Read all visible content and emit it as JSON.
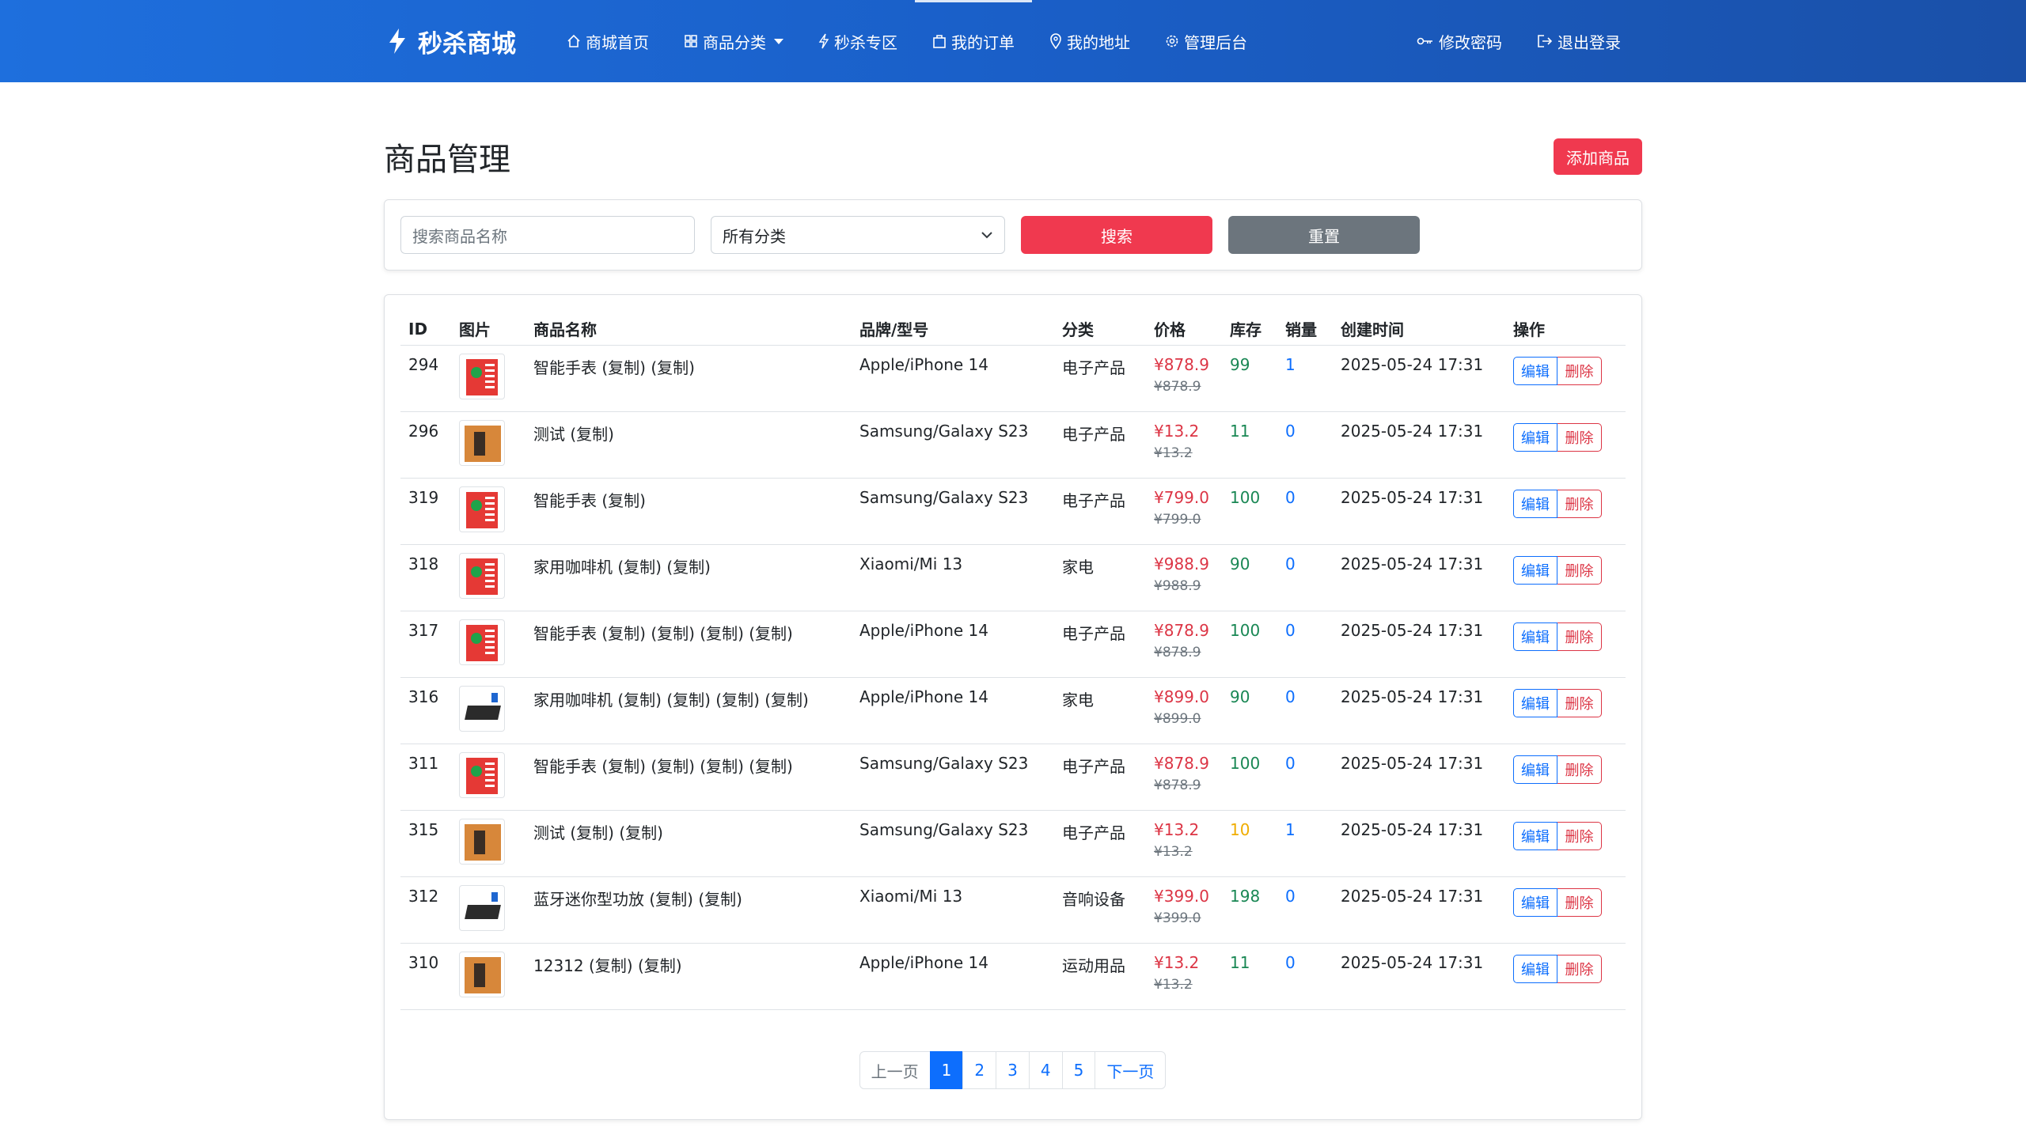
{
  "navbar": {
    "brand": "秒杀商城",
    "items": [
      {
        "label": "商城首页",
        "icon": "home-icon"
      },
      {
        "label": "商品分类",
        "icon": "grid-icon"
      },
      {
        "label": "秒杀专区",
        "icon": "lightning-icon"
      },
      {
        "label": "我的订单",
        "icon": "bag-icon"
      },
      {
        "label": "我的地址",
        "icon": "location-icon"
      },
      {
        "label": "管理后台",
        "icon": "gear-icon"
      }
    ],
    "right": [
      {
        "label": "修改密码",
        "icon": "key-icon"
      },
      {
        "label": "退出登录",
        "icon": "logout-icon"
      }
    ]
  },
  "page": {
    "title": "商品管理",
    "add_button": "添加商品"
  },
  "search": {
    "placeholder": "搜索商品名称",
    "category_selected": "所有分类",
    "search_button": "搜索",
    "reset_button": "重置"
  },
  "table": {
    "headers": [
      "ID",
      "图片",
      "商品名称",
      "品牌/型号",
      "分类",
      "价格",
      "库存",
      "销量",
      "创建时间",
      "操作"
    ],
    "edit_label": "编辑",
    "delete_label": "删除",
    "rows": [
      {
        "id": "294",
        "thumb": "watch",
        "name": "智能手表 (复制) (复制)",
        "brand": "Apple/iPhone 14",
        "category": "电子产品",
        "price": "¥878.9",
        "old_price": "¥878.9",
        "stock": "99",
        "stock_level": "ok",
        "sales": "1",
        "created": "2025-05-24 17:31"
      },
      {
        "id": "296",
        "thumb": "coffee",
        "name": "测试 (复制)",
        "brand": "Samsung/Galaxy S23",
        "category": "电子产品",
        "price": "¥13.2",
        "old_price": "¥13.2",
        "stock": "11",
        "stock_level": "ok",
        "sales": "0",
        "created": "2025-05-24 17:31"
      },
      {
        "id": "319",
        "thumb": "watch",
        "name": "智能手表 (复制)",
        "brand": "Samsung/Galaxy S23",
        "category": "电子产品",
        "price": "¥799.0",
        "old_price": "¥799.0",
        "stock": "100",
        "stock_level": "ok",
        "sales": "0",
        "created": "2025-05-24 17:31"
      },
      {
        "id": "318",
        "thumb": "watch",
        "name": "家用咖啡机 (复制) (复制)",
        "brand": "Xiaomi/Mi 13",
        "category": "家电",
        "price": "¥988.9",
        "old_price": "¥988.9",
        "stock": "90",
        "stock_level": "ok",
        "sales": "0",
        "created": "2025-05-24 17:31"
      },
      {
        "id": "317",
        "thumb": "watch",
        "name": "智能手表 (复制) (复制) (复制) (复制)",
        "brand": "Apple/iPhone 14",
        "category": "电子产品",
        "price": "¥878.9",
        "old_price": "¥878.9",
        "stock": "100",
        "stock_level": "ok",
        "sales": "0",
        "created": "2025-05-24 17:31"
      },
      {
        "id": "316",
        "thumb": "amp",
        "name": "家用咖啡机 (复制) (复制) (复制) (复制)",
        "brand": "Apple/iPhone 14",
        "category": "家电",
        "price": "¥899.0",
        "old_price": "¥899.0",
        "stock": "90",
        "stock_level": "ok",
        "sales": "0",
        "created": "2025-05-24 17:31"
      },
      {
        "id": "311",
        "thumb": "watch",
        "name": "智能手表 (复制) (复制) (复制) (复制)",
        "brand": "Samsung/Galaxy S23",
        "category": "电子产品",
        "price": "¥878.9",
        "old_price": "¥878.9",
        "stock": "100",
        "stock_level": "ok",
        "sales": "0",
        "created": "2025-05-24 17:31"
      },
      {
        "id": "315",
        "thumb": "coffee",
        "name": "测试 (复制) (复制)",
        "brand": "Samsung/Galaxy S23",
        "category": "电子产品",
        "price": "¥13.2",
        "old_price": "¥13.2",
        "stock": "10",
        "stock_level": "low",
        "sales": "1",
        "created": "2025-05-24 17:31"
      },
      {
        "id": "312",
        "thumb": "amp",
        "name": "蓝牙迷你型功放 (复制) (复制)",
        "brand": "Xiaomi/Mi 13",
        "category": "音响设备",
        "price": "¥399.0",
        "old_price": "¥399.0",
        "stock": "198",
        "stock_level": "ok",
        "sales": "0",
        "created": "2025-05-24 17:31"
      },
      {
        "id": "310",
        "thumb": "coffee",
        "name": "12312 (复制) (复制)",
        "brand": "Apple/iPhone 14",
        "category": "运动用品",
        "price": "¥13.2",
        "old_price": "¥13.2",
        "stock": "11",
        "stock_level": "ok",
        "sales": "0",
        "created": "2025-05-24 17:31"
      }
    ]
  },
  "pagination": {
    "prev": "上一页",
    "next": "下一页",
    "pages": [
      "1",
      "2",
      "3",
      "4",
      "5"
    ],
    "current": "1"
  }
}
